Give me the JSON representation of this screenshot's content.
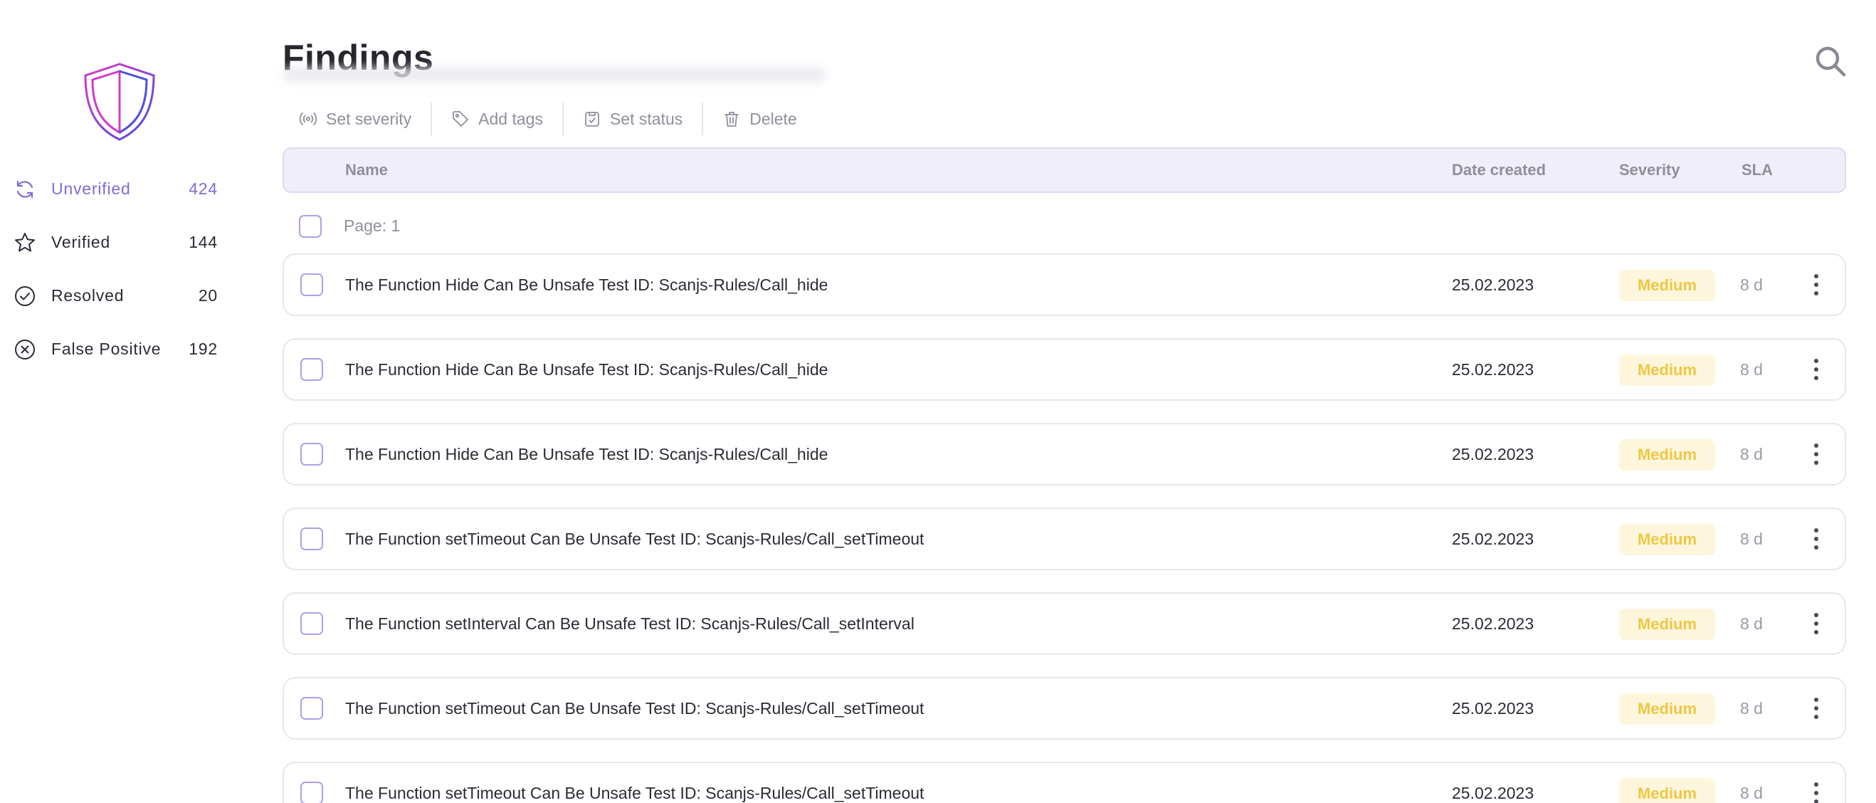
{
  "sidebar": {
    "logo": "shield-logo",
    "items": [
      {
        "label": "Unverified",
        "count": "424",
        "icon": "refresh-icon",
        "active": true
      },
      {
        "label": "Verified",
        "count": "144",
        "icon": "star-icon",
        "active": false
      },
      {
        "label": "Resolved",
        "count": "20",
        "icon": "check-circle-icon",
        "active": false
      },
      {
        "label": "False Positive",
        "count": "192",
        "icon": "x-circle-icon",
        "active": false
      }
    ]
  },
  "header": {
    "title": "Findings",
    "search_icon": "search-icon"
  },
  "toolbar": {
    "set_severity": "Set severity",
    "add_tags": "Add tags",
    "set_status": "Set status",
    "delete": "Delete"
  },
  "table": {
    "columns": {
      "name": "Name",
      "date_created": "Date created",
      "severity": "Severity",
      "sla": "SLA"
    },
    "page_label": "Page: 1",
    "rows": [
      {
        "name": "The Function Hide Can Be Unsafe Test ID: Scanjs-Rules/Call_hide",
        "date": "25.02.2023",
        "severity": "Medium",
        "sla": "8 d"
      },
      {
        "name": "The Function Hide Can Be Unsafe Test ID: Scanjs-Rules/Call_hide",
        "date": "25.02.2023",
        "severity": "Medium",
        "sla": "8 d"
      },
      {
        "name": "The Function Hide Can Be Unsafe Test ID: Scanjs-Rules/Call_hide",
        "date": "25.02.2023",
        "severity": "Medium",
        "sla": "8 d"
      },
      {
        "name": "The Function setTimeout Can Be Unsafe Test ID: Scanjs-Rules/Call_setTimeout",
        "date": "25.02.2023",
        "severity": "Medium",
        "sla": "8 d"
      },
      {
        "name": "The Function setInterval Can Be Unsafe Test ID: Scanjs-Rules/Call_setInterval",
        "date": "25.02.2023",
        "severity": "Medium",
        "sla": "8 d"
      },
      {
        "name": "The Function setTimeout Can Be Unsafe Test ID: Scanjs-Rules/Call_setTimeout",
        "date": "25.02.2023",
        "severity": "Medium",
        "sla": "8 d"
      },
      {
        "name": "The Function setTimeout Can Be Unsafe Test ID: Scanjs-Rules/Call_setTimeout",
        "date": "25.02.2023",
        "severity": "Medium",
        "sla": "8 d"
      }
    ]
  },
  "colors": {
    "accent": "#7b6fd6",
    "severity_medium_bg": "#fdf6dc",
    "severity_medium_text": "#efc743",
    "header_bg": "#efeef9"
  }
}
